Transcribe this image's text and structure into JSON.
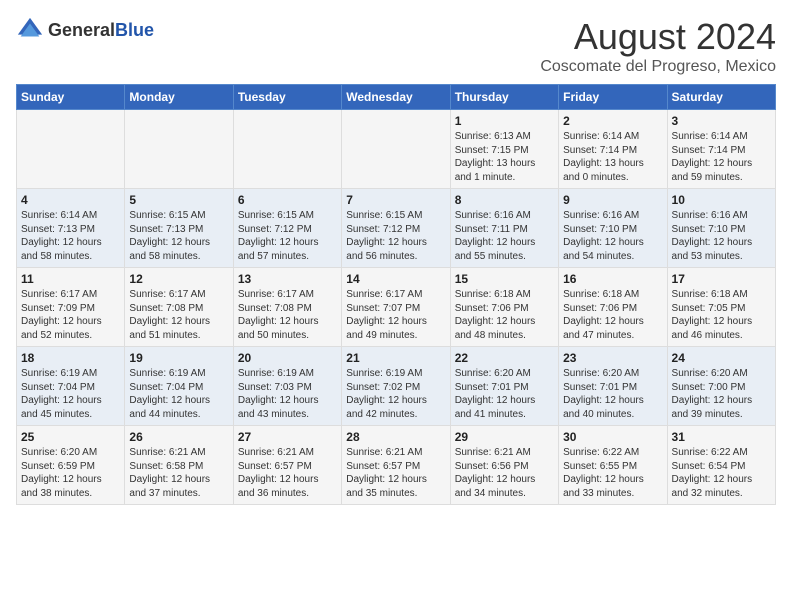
{
  "logo": {
    "general": "General",
    "blue": "Blue"
  },
  "title": "August 2024",
  "subtitle": "Coscomate del Progreso, Mexico",
  "days_of_week": [
    "Sunday",
    "Monday",
    "Tuesday",
    "Wednesday",
    "Thursday",
    "Friday",
    "Saturday"
  ],
  "weeks": [
    [
      {
        "day": "",
        "content": ""
      },
      {
        "day": "",
        "content": ""
      },
      {
        "day": "",
        "content": ""
      },
      {
        "day": "",
        "content": ""
      },
      {
        "day": "1",
        "content": "Sunrise: 6:13 AM\nSunset: 7:15 PM\nDaylight: 13 hours\nand 1 minute."
      },
      {
        "day": "2",
        "content": "Sunrise: 6:14 AM\nSunset: 7:14 PM\nDaylight: 13 hours\nand 0 minutes."
      },
      {
        "day": "3",
        "content": "Sunrise: 6:14 AM\nSunset: 7:14 PM\nDaylight: 12 hours\nand 59 minutes."
      }
    ],
    [
      {
        "day": "4",
        "content": "Sunrise: 6:14 AM\nSunset: 7:13 PM\nDaylight: 12 hours\nand 58 minutes."
      },
      {
        "day": "5",
        "content": "Sunrise: 6:15 AM\nSunset: 7:13 PM\nDaylight: 12 hours\nand 58 minutes."
      },
      {
        "day": "6",
        "content": "Sunrise: 6:15 AM\nSunset: 7:12 PM\nDaylight: 12 hours\nand 57 minutes."
      },
      {
        "day": "7",
        "content": "Sunrise: 6:15 AM\nSunset: 7:12 PM\nDaylight: 12 hours\nand 56 minutes."
      },
      {
        "day": "8",
        "content": "Sunrise: 6:16 AM\nSunset: 7:11 PM\nDaylight: 12 hours\nand 55 minutes."
      },
      {
        "day": "9",
        "content": "Sunrise: 6:16 AM\nSunset: 7:10 PM\nDaylight: 12 hours\nand 54 minutes."
      },
      {
        "day": "10",
        "content": "Sunrise: 6:16 AM\nSunset: 7:10 PM\nDaylight: 12 hours\nand 53 minutes."
      }
    ],
    [
      {
        "day": "11",
        "content": "Sunrise: 6:17 AM\nSunset: 7:09 PM\nDaylight: 12 hours\nand 52 minutes."
      },
      {
        "day": "12",
        "content": "Sunrise: 6:17 AM\nSunset: 7:08 PM\nDaylight: 12 hours\nand 51 minutes."
      },
      {
        "day": "13",
        "content": "Sunrise: 6:17 AM\nSunset: 7:08 PM\nDaylight: 12 hours\nand 50 minutes."
      },
      {
        "day": "14",
        "content": "Sunrise: 6:17 AM\nSunset: 7:07 PM\nDaylight: 12 hours\nand 49 minutes."
      },
      {
        "day": "15",
        "content": "Sunrise: 6:18 AM\nSunset: 7:06 PM\nDaylight: 12 hours\nand 48 minutes."
      },
      {
        "day": "16",
        "content": "Sunrise: 6:18 AM\nSunset: 7:06 PM\nDaylight: 12 hours\nand 47 minutes."
      },
      {
        "day": "17",
        "content": "Sunrise: 6:18 AM\nSunset: 7:05 PM\nDaylight: 12 hours\nand 46 minutes."
      }
    ],
    [
      {
        "day": "18",
        "content": "Sunrise: 6:19 AM\nSunset: 7:04 PM\nDaylight: 12 hours\nand 45 minutes."
      },
      {
        "day": "19",
        "content": "Sunrise: 6:19 AM\nSunset: 7:04 PM\nDaylight: 12 hours\nand 44 minutes."
      },
      {
        "day": "20",
        "content": "Sunrise: 6:19 AM\nSunset: 7:03 PM\nDaylight: 12 hours\nand 43 minutes."
      },
      {
        "day": "21",
        "content": "Sunrise: 6:19 AM\nSunset: 7:02 PM\nDaylight: 12 hours\nand 42 minutes."
      },
      {
        "day": "22",
        "content": "Sunrise: 6:20 AM\nSunset: 7:01 PM\nDaylight: 12 hours\nand 41 minutes."
      },
      {
        "day": "23",
        "content": "Sunrise: 6:20 AM\nSunset: 7:01 PM\nDaylight: 12 hours\nand 40 minutes."
      },
      {
        "day": "24",
        "content": "Sunrise: 6:20 AM\nSunset: 7:00 PM\nDaylight: 12 hours\nand 39 minutes."
      }
    ],
    [
      {
        "day": "25",
        "content": "Sunrise: 6:20 AM\nSunset: 6:59 PM\nDaylight: 12 hours\nand 38 minutes."
      },
      {
        "day": "26",
        "content": "Sunrise: 6:21 AM\nSunset: 6:58 PM\nDaylight: 12 hours\nand 37 minutes."
      },
      {
        "day": "27",
        "content": "Sunrise: 6:21 AM\nSunset: 6:57 PM\nDaylight: 12 hours\nand 36 minutes."
      },
      {
        "day": "28",
        "content": "Sunrise: 6:21 AM\nSunset: 6:57 PM\nDaylight: 12 hours\nand 35 minutes."
      },
      {
        "day": "29",
        "content": "Sunrise: 6:21 AM\nSunset: 6:56 PM\nDaylight: 12 hours\nand 34 minutes."
      },
      {
        "day": "30",
        "content": "Sunrise: 6:22 AM\nSunset: 6:55 PM\nDaylight: 12 hours\nand 33 minutes."
      },
      {
        "day": "31",
        "content": "Sunrise: 6:22 AM\nSunset: 6:54 PM\nDaylight: 12 hours\nand 32 minutes."
      }
    ]
  ]
}
